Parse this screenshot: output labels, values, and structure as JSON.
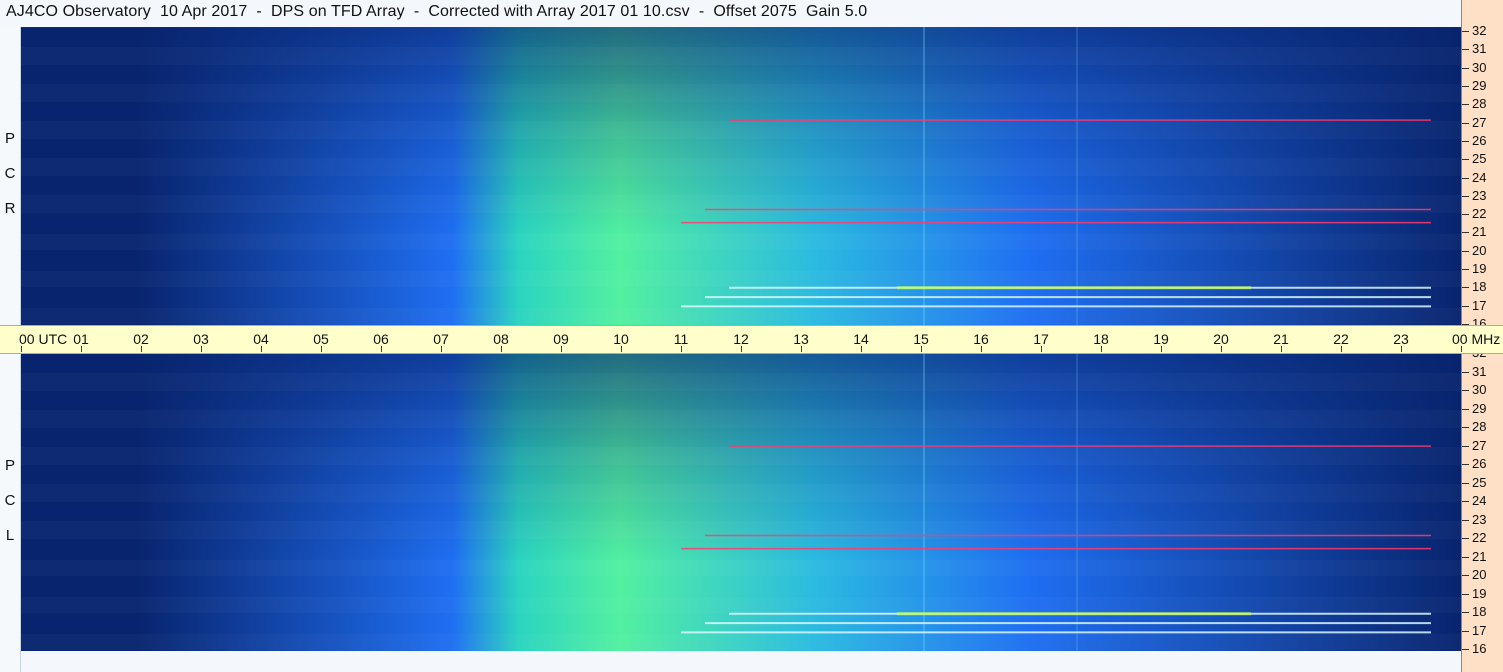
{
  "header": {
    "title": "AJ4CO Observatory  10 Apr 2017  -  DPS on TFD Array  -  Corrected with Array 2017 01 10.csv  -  Offset 2075  Gain 5.0"
  },
  "chart_data": {
    "type": "heatmap",
    "title": "AJ4CO Observatory  10 Apr 2017  -  DPS on TFD Array  -  Corrected with Array 2017 01 10.csv  -  Offset 2075  Gain 5.0",
    "xlabel": "UTC",
    "ylabel": "MHz",
    "x_ticks": [
      "00",
      "01",
      "02",
      "03",
      "04",
      "05",
      "06",
      "07",
      "08",
      "09",
      "10",
      "11",
      "12",
      "13",
      "14",
      "15",
      "16",
      "17",
      "18",
      "19",
      "20",
      "21",
      "22",
      "23",
      "00"
    ],
    "x_first_label": "00  UTC",
    "x_last_label": "00 MHz",
    "x_range_hours": [
      0,
      24
    ],
    "y_ticks": [
      "32",
      "31",
      "30",
      "29",
      "28",
      "27",
      "26",
      "25",
      "24",
      "23",
      "22",
      "21",
      "20",
      "19",
      "18",
      "17",
      "16"
    ],
    "y_range_mhz": [
      16,
      32
    ],
    "panels": [
      {
        "name": "RCP",
        "letters": [
          "P",
          "C",
          "R"
        ]
      },
      {
        "name": "LCP",
        "letters": [
          "P",
          "C",
          "L"
        ]
      }
    ],
    "daytime_peak_utc": 9.5,
    "interference_bands_mhz": [
      17,
      17.5,
      18,
      21.5,
      22.2,
      27
    ],
    "interference_start_utc": 11,
    "colors": {
      "low": "#08246e",
      "mid": "#1f6ff2",
      "high": "#52f0a0",
      "rfi": "#ff3b70",
      "time_band": "#ffffcc",
      "freq_scale": "#fde0c6"
    }
  }
}
